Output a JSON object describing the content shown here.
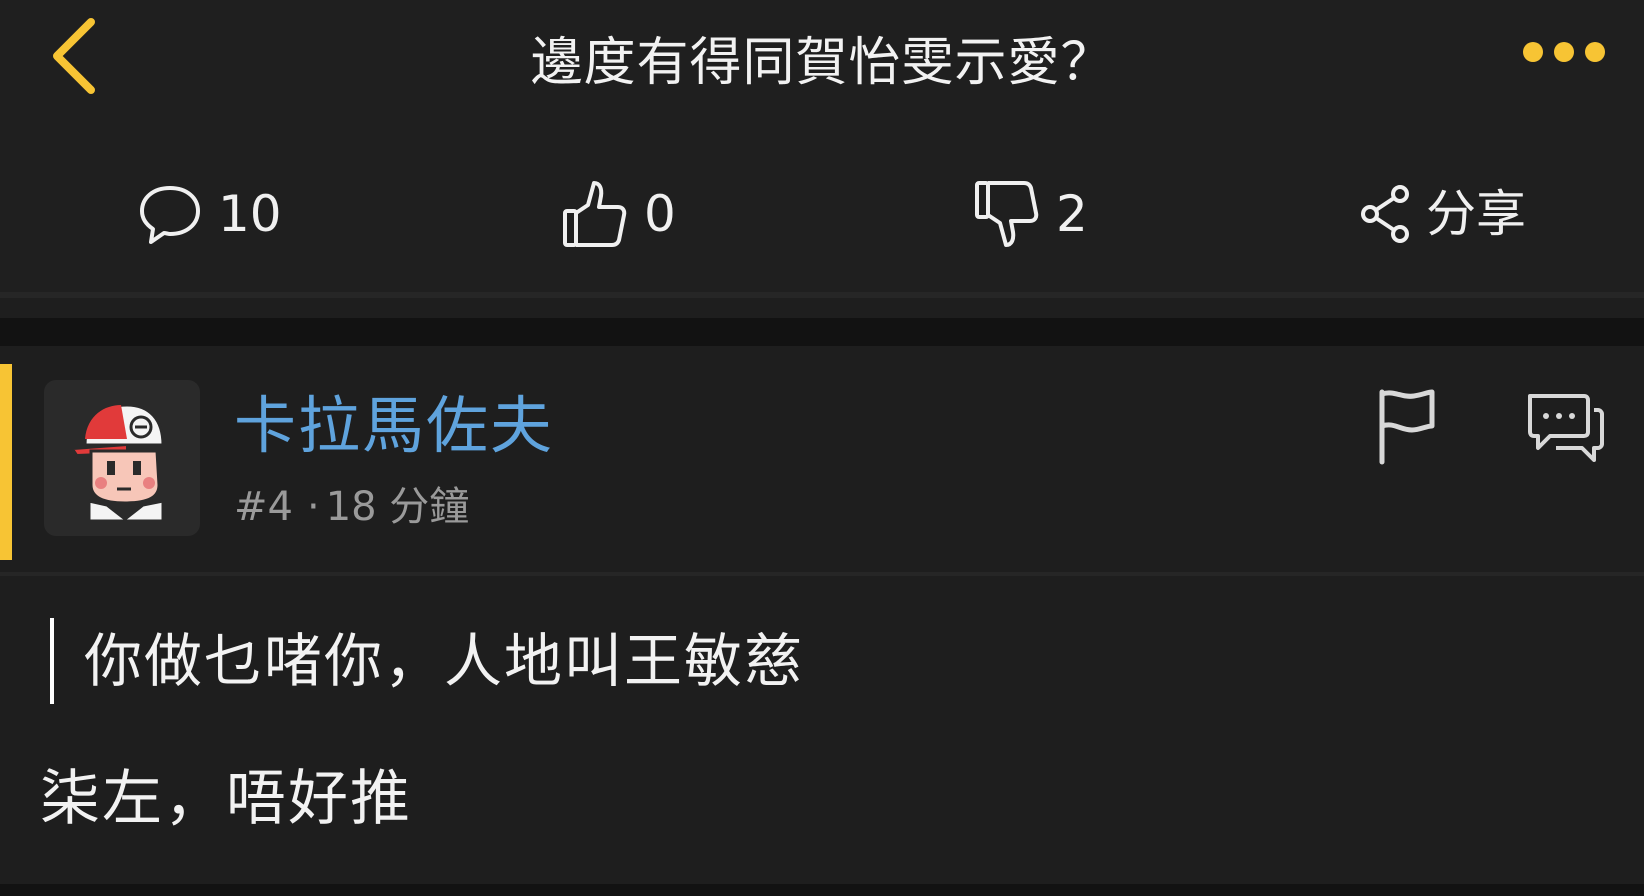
{
  "header": {
    "title": "邊度有得同賀怡雯示愛？",
    "back_icon": "chevron-left-icon",
    "more_icon": "more-dots-icon",
    "accent_color": "#f7c434"
  },
  "actions": {
    "comments": {
      "icon": "comment-icon",
      "count": "10"
    },
    "likes": {
      "icon": "thumbs-up-icon",
      "count": "0"
    },
    "dislikes": {
      "icon": "thumbs-down-icon",
      "count": "2"
    },
    "share": {
      "icon": "share-icon",
      "label": "分享"
    }
  },
  "post": {
    "username": "卡拉馬佐夫",
    "username_color": "#5fa3dd",
    "floor": "#4",
    "time": "18 分鐘",
    "avatar_icon": "avatar-icon",
    "flag_icon": "flag-icon",
    "reply_icon": "reply-chat-icon",
    "quote": "你做乜啫你，人地叫王敏慈",
    "content": "柒左，唔好推"
  }
}
